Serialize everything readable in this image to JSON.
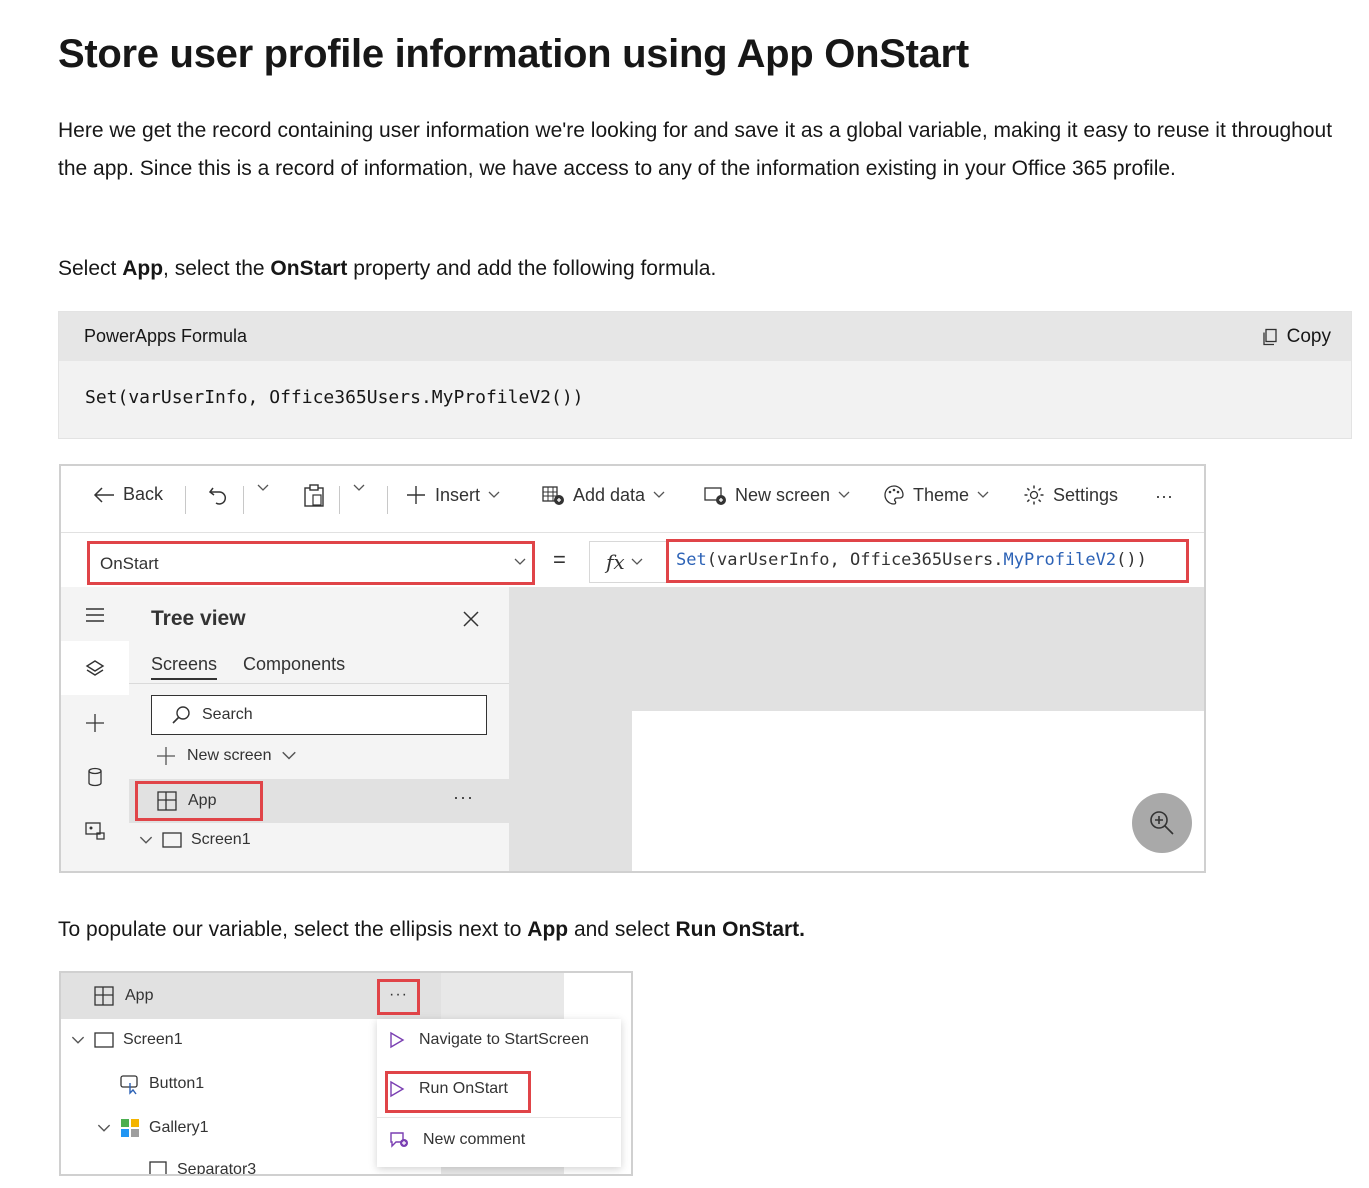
{
  "heading": "Store user profile information using App OnStart",
  "intro": "Here we get the record containing user information we're looking for and save it as a global variable, making it easy to reuse it throughout the app. Since this is a record of information, we have access to any of the information existing in your Office 365 profile.",
  "select_instruction": {
    "t1": "Select ",
    "b1": "App",
    "t2": ", select the ",
    "b2": "OnStart",
    "t3": " property and add the following formula."
  },
  "code_block": {
    "language": "PowerApps Formula",
    "copy_label": "Copy",
    "code": "Set(varUserInfo, Office365Users.MyProfileV2())"
  },
  "studio": {
    "toolbar": {
      "back": "Back",
      "insert": "Insert",
      "add_data": "Add data",
      "new_screen": "New screen",
      "theme": "Theme",
      "settings": "Settings",
      "more": "···"
    },
    "property": "OnStart",
    "equals": "=",
    "fx": "fx",
    "formula": {
      "p1": "Set",
      "p2": "(varUserInfo, Office365Users.",
      "p3": "MyProfileV2",
      "p4": "())"
    },
    "tree": {
      "title": "Tree view",
      "tab_screens": "Screens",
      "tab_components": "Components",
      "search_placeholder": "Search",
      "new_screen": "New screen",
      "app": "App",
      "app_more": "···",
      "screen1": "Screen1"
    }
  },
  "populate_instruction": {
    "t1": "To populate our variable, select the ellipsis next to ",
    "b1": "App",
    "t2": " and select ",
    "b2": "Run OnStart."
  },
  "context_menu_shot": {
    "app": "App",
    "dots": "···",
    "screen1": "Screen1",
    "button1": "Button1",
    "gallery1": "Gallery1",
    "separator3": "Separator3",
    "menu": {
      "navigate": "Navigate to StartScreen",
      "run_onstart": "Run OnStart",
      "new_comment": "New comment"
    }
  }
}
